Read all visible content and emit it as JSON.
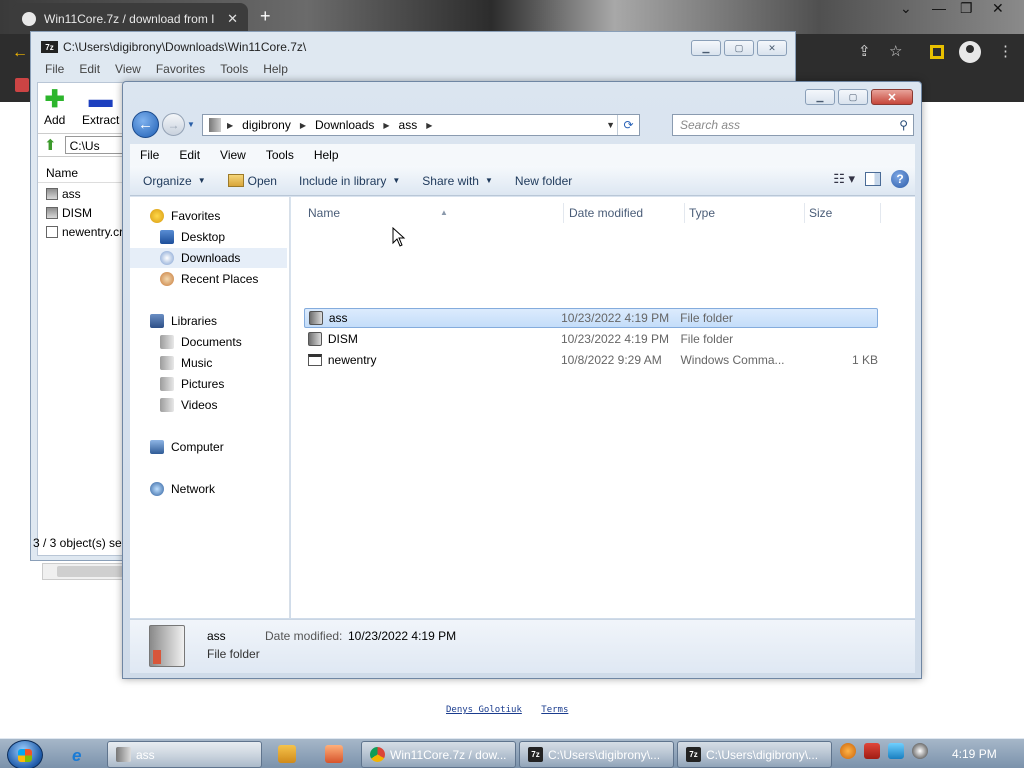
{
  "browser": {
    "tab_title": "Win11Core.7z / download from I",
    "tab_close": "✕",
    "new_tab": "+",
    "footer_links": [
      "Denys Golotiuk",
      "Terms"
    ]
  },
  "sevenzip": {
    "title": "C:\\Users\\digibrony\\Downloads\\Win11Core.7z\\",
    "logo": "7z",
    "menu": [
      "File",
      "Edit",
      "View",
      "Favorites",
      "Tools",
      "Help"
    ],
    "toolbar": {
      "add": "Add",
      "extract": "Extract"
    },
    "path": "C:\\Us",
    "column_name": "Name",
    "rows": [
      "ass",
      "DISM",
      "newentry.cr"
    ],
    "status": "3 / 3 object(s) se"
  },
  "explorer": {
    "breadcrumb": [
      "digibrony",
      "Downloads",
      "ass"
    ],
    "search_placeholder": "Search ass",
    "menu": [
      "File",
      "Edit",
      "View",
      "Tools",
      "Help"
    ],
    "commands": {
      "organize": "Organize",
      "open": "Open",
      "include": "Include in library",
      "share": "Share with",
      "new_folder": "New folder"
    },
    "nav": {
      "favorites": "Favorites",
      "desktop": "Desktop",
      "downloads": "Downloads",
      "recent": "Recent Places",
      "libraries": "Libraries",
      "documents": "Documents",
      "music": "Music",
      "pictures": "Pictures",
      "videos": "Videos",
      "computer": "Computer",
      "network": "Network"
    },
    "columns": {
      "name": "Name",
      "date": "Date modified",
      "type": "Type",
      "size": "Size"
    },
    "files": [
      {
        "name": "ass",
        "date": "10/23/2022 4:19 PM",
        "type": "File folder",
        "size": ""
      },
      {
        "name": "DISM",
        "date": "10/23/2022 4:19 PM",
        "type": "File folder",
        "size": ""
      },
      {
        "name": "newentry",
        "date": "10/8/2022 9:29 AM",
        "type": "Windows Comma...",
        "size": "1 KB"
      }
    ],
    "details": {
      "name": "ass",
      "type": "File folder",
      "date_label": "Date modified:",
      "date_value": "10/23/2022 4:19 PM"
    }
  },
  "taskbar": {
    "items": [
      "ass",
      "Win11Core.7z / dow...",
      "C:\\Users\\digibrony\\...",
      "C:\\Users\\digibrony\\..."
    ],
    "clock": "4:19 PM"
  }
}
